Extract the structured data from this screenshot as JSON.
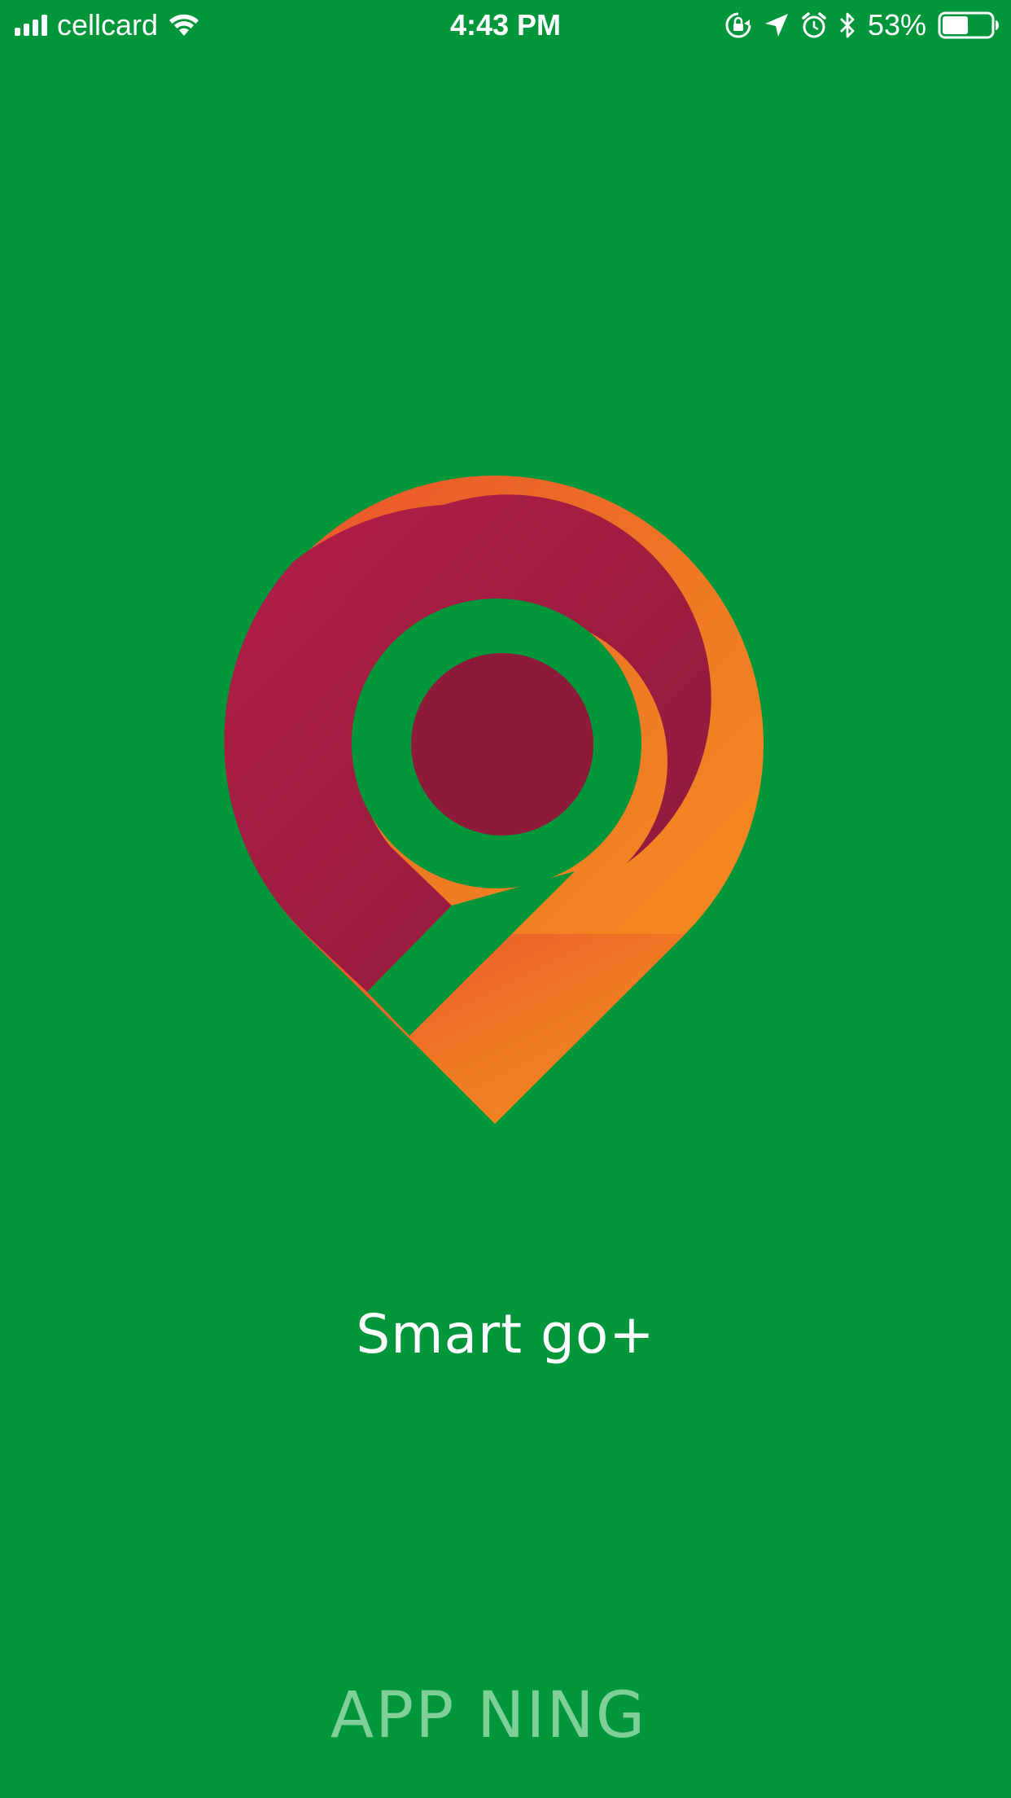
{
  "status_bar": {
    "carrier": "cellcard",
    "time": "4:43 PM",
    "battery_percent": "53%",
    "battery_level": 0.53,
    "icons": [
      "signal-icon",
      "wifi-icon",
      "orientation-lock-icon",
      "location-icon",
      "alarm-icon",
      "bluetooth-icon",
      "battery-icon"
    ]
  },
  "splash": {
    "logo": "smart-go-pin-logo",
    "title": "Smart go+",
    "footer": "APP NING"
  },
  "colors": {
    "background": "#009639",
    "logo_orange": "#F28A21",
    "logo_red": "#B21E47",
    "logo_dark_red": "#8E1A3A",
    "footer_text": "#7fcf98"
  }
}
